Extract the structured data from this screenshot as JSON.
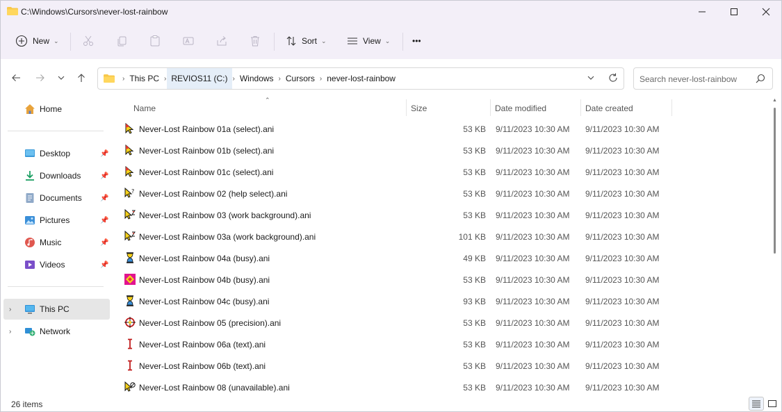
{
  "window": {
    "title": "C:\\Windows\\Cursors\\never-lost-rainbow"
  },
  "toolbar": {
    "new_label": "New",
    "sort_label": "Sort",
    "view_label": "View",
    "more_label": "•••"
  },
  "address": {
    "crumbs": [
      "This PC",
      "REVIOS11 (C:)",
      "Windows",
      "Cursors",
      "never-lost-rainbow"
    ],
    "search_placeholder": "Search never-lost-rainbow"
  },
  "sidebar": {
    "home": "Home",
    "quick": [
      "Desktop",
      "Downloads",
      "Documents",
      "Pictures",
      "Music",
      "Videos"
    ],
    "this_pc": "This PC",
    "network": "Network"
  },
  "columns": {
    "name": "Name",
    "size": "Size",
    "modified": "Date modified",
    "created": "Date created"
  },
  "files": [
    {
      "name": "Never-Lost Rainbow 01a (select).ani",
      "size": "53 KB",
      "modified": "9/11/2023 10:30 AM",
      "created": "9/11/2023 10:30 AM",
      "icon": "arrow-cursor-icon"
    },
    {
      "name": "Never-Lost Rainbow 01b (select).ani",
      "size": "53 KB",
      "modified": "9/11/2023 10:30 AM",
      "created": "9/11/2023 10:30 AM",
      "icon": "arrow-cursor-icon"
    },
    {
      "name": "Never-Lost Rainbow 01c (select).ani",
      "size": "53 KB",
      "modified": "9/11/2023 10:30 AM",
      "created": "9/11/2023 10:30 AM",
      "icon": "arrow-cursor-icon"
    },
    {
      "name": "Never-Lost Rainbow 02 (help select).ani",
      "size": "53 KB",
      "modified": "9/11/2023 10:30 AM",
      "created": "9/11/2023 10:30 AM",
      "icon": "help-cursor-icon"
    },
    {
      "name": "Never-Lost Rainbow 03 (work background).ani",
      "size": "53 KB",
      "modified": "9/11/2023 10:30 AM",
      "created": "9/11/2023 10:30 AM",
      "icon": "working-cursor-icon"
    },
    {
      "name": "Never-Lost Rainbow 03a (work background).ani",
      "size": "101 KB",
      "modified": "9/11/2023 10:30 AM",
      "created": "9/11/2023 10:30 AM",
      "icon": "working-cursor-icon"
    },
    {
      "name": "Never-Lost Rainbow 04a (busy).ani",
      "size": "49 KB",
      "modified": "9/11/2023 10:30 AM",
      "created": "9/11/2023 10:30 AM",
      "icon": "hourglass-icon"
    },
    {
      "name": "Never-Lost Rainbow 04b (busy).ani",
      "size": "53 KB",
      "modified": "9/11/2023 10:30 AM",
      "created": "9/11/2023 10:30 AM",
      "icon": "busy-diamond-icon"
    },
    {
      "name": "Never-Lost Rainbow 04c (busy).ani",
      "size": "93 KB",
      "modified": "9/11/2023 10:30 AM",
      "created": "9/11/2023 10:30 AM",
      "icon": "hourglass-icon"
    },
    {
      "name": "Never-Lost Rainbow 05 (precision).ani",
      "size": "53 KB",
      "modified": "9/11/2023 10:30 AM",
      "created": "9/11/2023 10:30 AM",
      "icon": "precision-cursor-icon"
    },
    {
      "name": "Never-Lost Rainbow 06a (text).ani",
      "size": "53 KB",
      "modified": "9/11/2023 10:30 AM",
      "created": "9/11/2023 10:30 AM",
      "icon": "text-cursor-icon"
    },
    {
      "name": "Never-Lost Rainbow 06b (text).ani",
      "size": "53 KB",
      "modified": "9/11/2023 10:30 AM",
      "created": "9/11/2023 10:30 AM",
      "icon": "text-cursor-icon"
    },
    {
      "name": "Never-Lost Rainbow 08 (unavailable).ani",
      "size": "53 KB",
      "modified": "9/11/2023 10:30 AM",
      "created": "9/11/2023 10:30 AM",
      "icon": "unavailable-cursor-icon"
    }
  ],
  "status": {
    "items_count": "26 items"
  },
  "colors": {
    "chrome": "#f3eff8",
    "selected": "#e6e6e6",
    "folder": "#f8c84b",
    "accent": "#005fb8"
  }
}
